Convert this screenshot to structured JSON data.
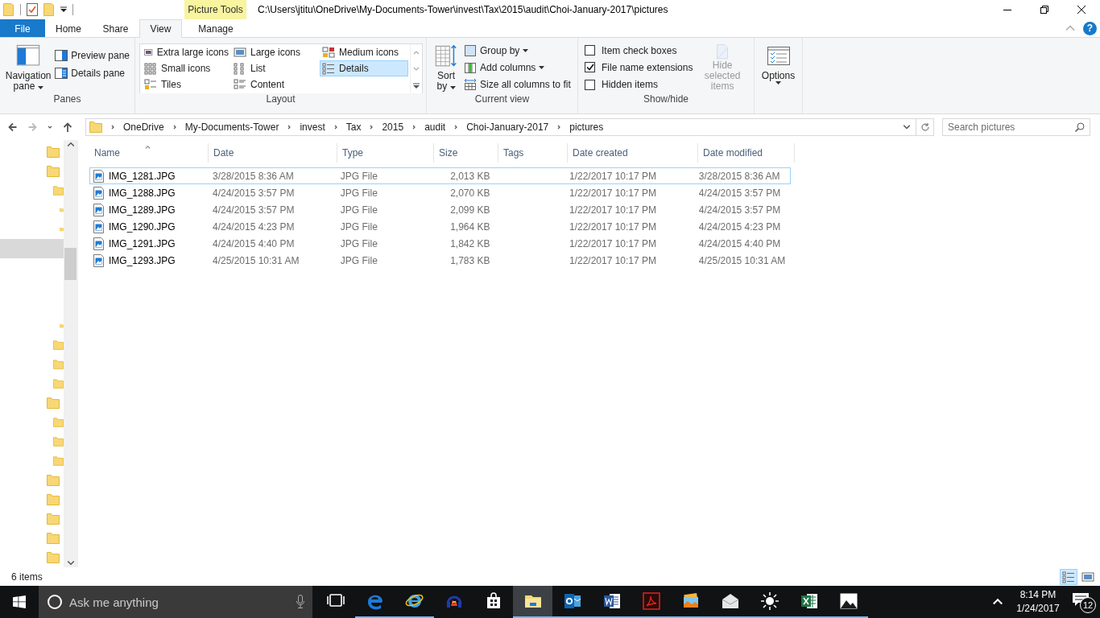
{
  "title_bar": {
    "contextual_tab": "Picture Tools",
    "path": "C:\\Users\\jtitu\\OneDrive\\My-Documents-Tower\\invest\\Tax\\2015\\audit\\Choi-January-2017\\pictures",
    "help": "?"
  },
  "tabs": [
    {
      "label": "File",
      "kind": "file",
      "selected": false
    },
    {
      "label": "Home",
      "kind": "tab",
      "selected": false
    },
    {
      "label": "Share",
      "kind": "tab",
      "selected": false
    },
    {
      "label": "View",
      "kind": "tab",
      "selected": true
    },
    {
      "label": "Manage",
      "kind": "contextual",
      "selected": false
    }
  ],
  "ribbon": {
    "panes": {
      "label": "Panes",
      "large": "Navigation pane",
      "items": [
        {
          "label": "Preview pane",
          "kind": "preview"
        },
        {
          "label": "Details pane",
          "kind": "details"
        }
      ]
    },
    "layout": {
      "label": "Layout",
      "options": [
        {
          "label": "Extra large icons",
          "kind": "xl",
          "selected": false
        },
        {
          "label": "Large icons",
          "kind": "large",
          "selected": false
        },
        {
          "label": "Medium icons",
          "kind": "medium",
          "selected": false
        },
        {
          "label": "Small icons",
          "kind": "small",
          "selected": false
        },
        {
          "label": "List",
          "kind": "list",
          "selected": false
        },
        {
          "label": "Details",
          "kind": "details",
          "selected": true
        },
        {
          "label": "Tiles",
          "kind": "tiles",
          "selected": false
        },
        {
          "label": "Content",
          "kind": "content",
          "selected": false
        }
      ]
    },
    "current_view": {
      "label": "Current view",
      "sort": "Sort by",
      "items": [
        {
          "label": "Group by",
          "kind": "group",
          "dropdown": true
        },
        {
          "label": "Add columns",
          "kind": "add",
          "dropdown": true
        },
        {
          "label": "Size all columns to fit",
          "kind": "size",
          "dropdown": false
        }
      ]
    },
    "show_hide": {
      "label": "Show/hide",
      "checkboxes": [
        {
          "label": "Item check boxes",
          "checked": false
        },
        {
          "label": "File name extensions",
          "checked": true
        },
        {
          "label": "Hidden items",
          "checked": false
        }
      ],
      "hide_selected": {
        "label": "Hide selected items",
        "disabled": true
      }
    },
    "options": {
      "label": "Options"
    }
  },
  "address": {
    "crumbs": [
      "OneDrive",
      "My-Documents-Tower",
      "invest",
      "Tax",
      "2015",
      "audit",
      "Choi-January-2017",
      "pictures"
    ],
    "search_placeholder": "Search pictures"
  },
  "nav_tree": [
    {
      "kind": "folder",
      "selected": false
    },
    {
      "kind": "folder",
      "selected": false,
      "children": [
        {
          "kind": "folder",
          "selected": false,
          "children": [
            {
              "kind": "folder",
              "selected": false
            },
            {
              "kind": "folder",
              "selected": false
            },
            {
              "kind": "blank",
              "selected": true
            },
            {
              "kind": "blank",
              "selected": false
            },
            {
              "kind": "blank",
              "selected": false
            },
            {
              "kind": "blank",
              "selected": false
            },
            {
              "kind": "folder",
              "selected": false
            }
          ]
        },
        {
          "kind": "folder",
          "selected": false
        },
        {
          "kind": "folder",
          "selected": false
        },
        {
          "kind": "folder",
          "selected": false
        }
      ]
    },
    {
      "kind": "folder",
      "selected": false,
      "children": [
        {
          "kind": "folder",
          "selected": false
        },
        {
          "kind": "folder",
          "selected": false
        },
        {
          "kind": "folder",
          "selected": false
        }
      ]
    },
    {
      "kind": "folder",
      "selected": false
    },
    {
      "kind": "folder",
      "selected": false
    },
    {
      "kind": "folder",
      "selected": false
    },
    {
      "kind": "folder",
      "selected": false
    },
    {
      "kind": "folder",
      "selected": false
    }
  ],
  "table": {
    "columns": [
      "Name",
      "Date",
      "Type",
      "Size",
      "Tags",
      "Date created",
      "Date modified"
    ],
    "rows": [
      {
        "focused": true,
        "cells": [
          "IMG_1281.JPG",
          "3/28/2015 8:36 AM",
          "JPG File",
          "2,013 KB",
          "",
          "1/22/2017 10:17 PM",
          "3/28/2015 8:36 AM"
        ]
      },
      {
        "focused": false,
        "cells": [
          "IMG_1288.JPG",
          "4/24/2015 3:57 PM",
          "JPG File",
          "2,070 KB",
          "",
          "1/22/2017 10:17 PM",
          "4/24/2015 3:57 PM"
        ]
      },
      {
        "focused": false,
        "cells": [
          "IMG_1289.JPG",
          "4/24/2015 3:57 PM",
          "JPG File",
          "2,099 KB",
          "",
          "1/22/2017 10:17 PM",
          "4/24/2015 3:57 PM"
        ]
      },
      {
        "focused": false,
        "cells": [
          "IMG_1290.JPG",
          "4/24/2015 4:23 PM",
          "JPG File",
          "1,964 KB",
          "",
          "1/22/2017 10:17 PM",
          "4/24/2015 4:23 PM"
        ]
      },
      {
        "focused": false,
        "cells": [
          "IMG_1291.JPG",
          "4/24/2015 4:40 PM",
          "JPG File",
          "1,842 KB",
          "",
          "1/22/2017 10:17 PM",
          "4/24/2015 4:40 PM"
        ]
      },
      {
        "focused": false,
        "cells": [
          "IMG_1293.JPG",
          "4/25/2015 10:31 AM",
          "JPG File",
          "1,783 KB",
          "",
          "1/22/2017 10:17 PM",
          "4/25/2015 10:31 AM"
        ]
      }
    ]
  },
  "status_bar": {
    "count": "6 items",
    "views": [
      {
        "kind": "details",
        "selected": true
      },
      {
        "kind": "large",
        "selected": false
      }
    ]
  },
  "taskbar": {
    "search_placeholder": "Ask me anything",
    "apps": [
      {
        "kind": "task-view",
        "running": false,
        "active": false
      },
      {
        "kind": "edge",
        "running": true,
        "active": false
      },
      {
        "kind": "ie",
        "running": true,
        "active": false
      },
      {
        "kind": "headphones",
        "running": false,
        "active": false
      },
      {
        "kind": "store",
        "running": false,
        "active": false
      },
      {
        "kind": "explorer",
        "running": true,
        "active": true
      },
      {
        "kind": "outlook",
        "running": true,
        "active": false
      },
      {
        "kind": "word",
        "running": true,
        "active": false
      },
      {
        "kind": "acrobat",
        "running": true,
        "active": false
      },
      {
        "kind": "gallery",
        "running": true,
        "active": false
      },
      {
        "kind": "mail",
        "running": true,
        "active": false
      },
      {
        "kind": "sun",
        "running": true,
        "active": false
      },
      {
        "kind": "excel",
        "running": true,
        "active": false
      },
      {
        "kind": "photos",
        "running": true,
        "active": false
      }
    ],
    "time": "8:14 PM",
    "date": "1/24/2017",
    "notifications": "12"
  }
}
